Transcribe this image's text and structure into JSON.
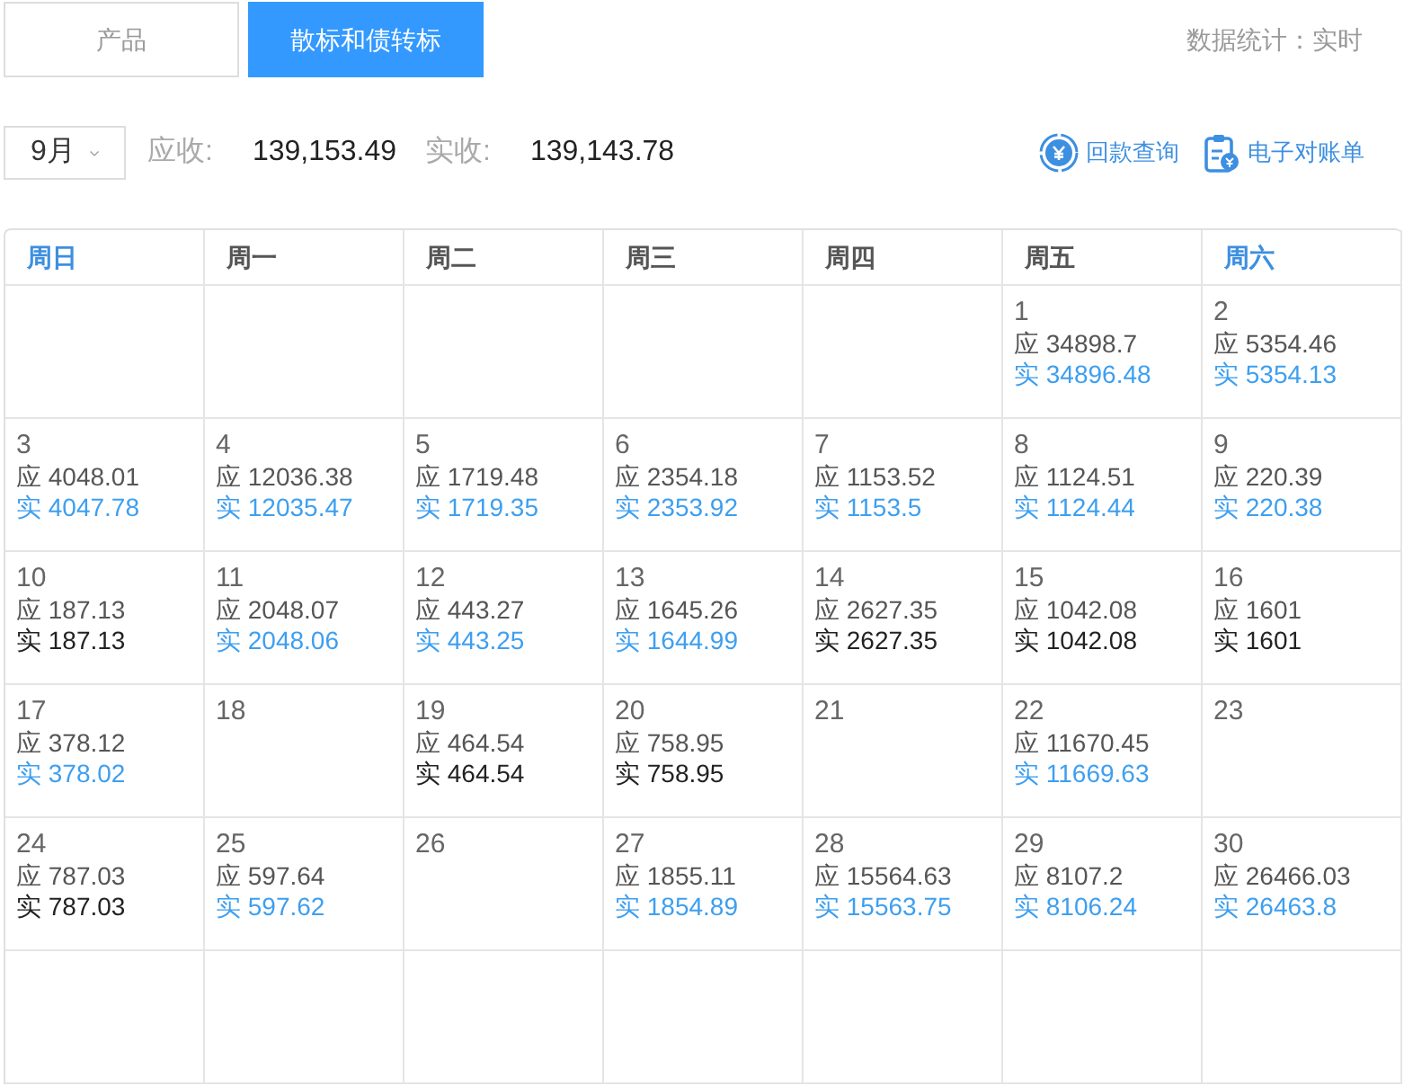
{
  "tabs": [
    {
      "label": "产品",
      "selected": false
    },
    {
      "label": "散标和债转标",
      "selected": true
    }
  ],
  "stats_note": "数据统计：实时",
  "month_select": {
    "value": "9月"
  },
  "summary": [
    {
      "label": "应收:",
      "value": "139,153.49"
    },
    {
      "label": "实收:",
      "value": "139,143.78"
    }
  ],
  "actions": [
    {
      "kind": "repayment",
      "label": "回款查询"
    },
    {
      "kind": "statement",
      "label": "电子对账单"
    }
  ],
  "weekdays": [
    {
      "label": "周日",
      "color": "#3d8fe0"
    },
    {
      "label": "周一",
      "color": "#555555"
    },
    {
      "label": "周二",
      "color": "#555555"
    },
    {
      "label": "周三",
      "color": "#555555"
    },
    {
      "label": "周四",
      "color": "#555555"
    },
    {
      "label": "周五",
      "color": "#555555"
    },
    {
      "label": "周六",
      "color": "#3d8fe0"
    }
  ],
  "weeks": [
    [
      {
        "kind": "empty"
      },
      {
        "kind": "empty"
      },
      {
        "kind": "empty"
      },
      {
        "kind": "empty"
      },
      {
        "kind": "empty"
      },
      {
        "kind": "day",
        "day": "1",
        "due": "应 34898.7",
        "paid": {
          "text": "实 34896.48",
          "color": "#3d9ff0"
        }
      },
      {
        "kind": "day",
        "day": "2",
        "due": "应 5354.46",
        "paid": {
          "text": "实 5354.13",
          "color": "#3d9ff0"
        }
      }
    ],
    [
      {
        "kind": "day",
        "day": "3",
        "due": "应 4048.01",
        "paid": {
          "text": "实 4047.78",
          "color": "#3d9ff0"
        }
      },
      {
        "kind": "day",
        "day": "4",
        "due": "应 12036.38",
        "paid": {
          "text": "实 12035.47",
          "color": "#3d9ff0"
        }
      },
      {
        "kind": "day",
        "day": "5",
        "due": "应 1719.48",
        "paid": {
          "text": "实 1719.35",
          "color": "#3d9ff0"
        }
      },
      {
        "kind": "day",
        "day": "6",
        "due": "应 2354.18",
        "paid": {
          "text": "实 2353.92",
          "color": "#3d9ff0"
        }
      },
      {
        "kind": "day",
        "day": "7",
        "due": "应 1153.52",
        "paid": {
          "text": "实 1153.5",
          "color": "#3d9ff0"
        }
      },
      {
        "kind": "day",
        "day": "8",
        "due": "应 1124.51",
        "paid": {
          "text": "实 1124.44",
          "color": "#3d9ff0"
        }
      },
      {
        "kind": "day",
        "day": "9",
        "due": "应 220.39",
        "paid": {
          "text": "实 220.38",
          "color": "#3d9ff0"
        }
      }
    ],
    [
      {
        "kind": "day",
        "day": "10",
        "due": "应 187.13",
        "paid": {
          "text": "实 187.13",
          "color": "#222222"
        }
      },
      {
        "kind": "day",
        "day": "11",
        "due": "应 2048.07",
        "paid": {
          "text": "实 2048.06",
          "color": "#3d9ff0"
        }
      },
      {
        "kind": "day",
        "day": "12",
        "due": "应 443.27",
        "paid": {
          "text": "实 443.25",
          "color": "#3d9ff0"
        }
      },
      {
        "kind": "day",
        "day": "13",
        "due": "应 1645.26",
        "paid": {
          "text": "实 1644.99",
          "color": "#3d9ff0"
        }
      },
      {
        "kind": "day",
        "day": "14",
        "due": "应 2627.35",
        "paid": {
          "text": "实 2627.35",
          "color": "#222222"
        }
      },
      {
        "kind": "day",
        "day": "15",
        "due": "应 1042.08",
        "paid": {
          "text": "实 1042.08",
          "color": "#222222"
        }
      },
      {
        "kind": "day",
        "day": "16",
        "due": "应 1601",
        "paid": {
          "text": "实 1601",
          "color": "#222222"
        }
      }
    ],
    [
      {
        "kind": "day",
        "day": "17",
        "due": "应 378.12",
        "paid": {
          "text": "实 378.02",
          "color": "#3d9ff0"
        }
      },
      {
        "kind": "day",
        "day": "18"
      },
      {
        "kind": "day",
        "day": "19",
        "due": "应 464.54",
        "paid": {
          "text": "实 464.54",
          "color": "#222222"
        }
      },
      {
        "kind": "day",
        "day": "20",
        "due": "应 758.95",
        "paid": {
          "text": "实 758.95",
          "color": "#222222"
        }
      },
      {
        "kind": "day",
        "day": "21"
      },
      {
        "kind": "day",
        "day": "22",
        "due": "应 11670.45",
        "paid": {
          "text": "实 11669.63",
          "color": "#3d9ff0"
        }
      },
      {
        "kind": "day",
        "day": "23"
      }
    ],
    [
      {
        "kind": "day",
        "day": "24",
        "due": "应 787.03",
        "paid": {
          "text": "实 787.03",
          "color": "#222222"
        }
      },
      {
        "kind": "day",
        "day": "25",
        "due": "应 597.64",
        "paid": {
          "text": "实 597.62",
          "color": "#3d9ff0"
        }
      },
      {
        "kind": "day",
        "day": "26"
      },
      {
        "kind": "day",
        "day": "27",
        "due": "应 1855.11",
        "paid": {
          "text": "实 1854.89",
          "color": "#3d9ff0"
        }
      },
      {
        "kind": "day",
        "day": "28",
        "due": "应 15564.63",
        "paid": {
          "text": "实 15563.75",
          "color": "#3d9ff0"
        }
      },
      {
        "kind": "day",
        "day": "29",
        "due": "应 8107.2",
        "paid": {
          "text": "实 8106.24",
          "color": "#3d9ff0"
        }
      },
      {
        "kind": "day",
        "day": "30",
        "due": "应 26466.03",
        "paid": {
          "text": "实 26463.8",
          "color": "#3d9ff0"
        }
      }
    ],
    [
      {
        "kind": "empty"
      },
      {
        "kind": "empty"
      },
      {
        "kind": "empty"
      },
      {
        "kind": "empty"
      },
      {
        "kind": "empty"
      },
      {
        "kind": "empty"
      },
      {
        "kind": "empty"
      }
    ]
  ]
}
